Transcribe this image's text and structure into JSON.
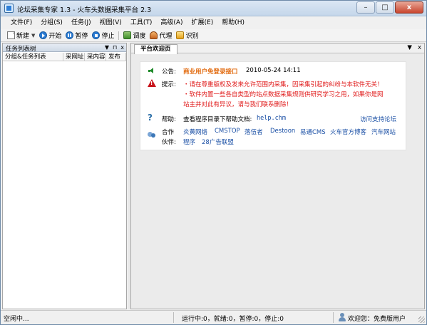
{
  "window": {
    "title": "论坛采集专家 1.3 - 火车头数据采集平台 2.3",
    "controls": {
      "minimize": "–",
      "maximize": "□",
      "close": "x"
    }
  },
  "menu": [
    "文件(F)",
    "分组(S)",
    "任务(J)",
    "视图(V)",
    "工具(T)",
    "高级(A)",
    "扩展(E)",
    "帮助(H)"
  ],
  "toolbar": {
    "new": "新建",
    "start": "开始",
    "pause": "暂停",
    "stop": "停止",
    "schedule": "调度",
    "proxy": "代理",
    "ocr": "识别"
  },
  "left_panel": {
    "title": "任务列表树",
    "controls": [
      "▼",
      "⊓",
      "x"
    ],
    "columns": [
      "分组&任务列表",
      "采网址",
      "采内容",
      "发布"
    ]
  },
  "tab": {
    "label": "平台欢迎页",
    "controls": [
      "▼",
      "x"
    ]
  },
  "welcome": {
    "announce_label": "公告:",
    "announce_link": "商业用户免登录接口",
    "announce_date": "2010-05-24 14:11",
    "tip_label": "提示:",
    "tip_lines": [
      "・请在尊重版权及发来允许范围内采集，因采集引起的纠纷与本软件无关！",
      "・软件内置一些各自类型的站点数据采集规则供研究学习之用，如果你是网",
      "站主并对此有异议，请与我们联系删除！"
    ],
    "help_label": "帮助:",
    "help_text": "查看程序目录下帮助文档:",
    "help_file": "help.chm",
    "support_link": "访问支持论坛",
    "partner_label_1": "合作",
    "partner_label_2": "伙伴:",
    "partners_row1": [
      "炎黄网络",
      "CMSTOP",
      "落伍者",
      "Destoon",
      "易通CMS",
      "火车官方博客",
      "汽车网站"
    ],
    "partners_row2": [
      "程序",
      "28广告联盟"
    ]
  },
  "status": {
    "left": "空闲中...",
    "counts": "运行中:0，就绪:0，暂停:0，停止:0",
    "user": "欢迎您：免费版用户"
  }
}
